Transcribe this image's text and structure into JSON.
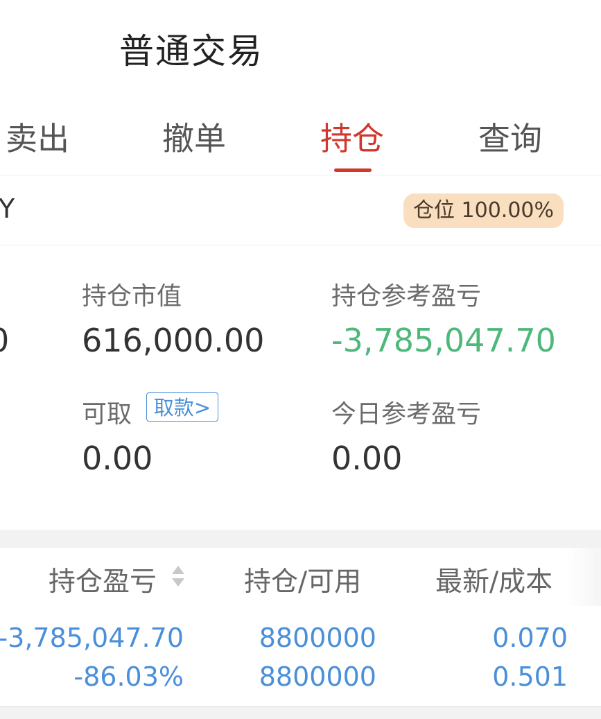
{
  "header": {
    "title": "普通交易"
  },
  "tabs": [
    {
      "label": "卖出",
      "active": false
    },
    {
      "label": "撤单",
      "active": false
    },
    {
      "label": "持仓",
      "active": true
    },
    {
      "label": "查询",
      "active": false
    }
  ],
  "account": {
    "name_fragment": "Y",
    "position_badge": "仓位 100.00%"
  },
  "summary": {
    "left_partial_value": "0",
    "market_value_label": "持仓市值",
    "market_value": "616,000.00",
    "ref_pl_label": "持仓参考盈亏",
    "ref_pl": "-3,785,047.70",
    "withdrawable_label": "可取",
    "withdraw_button": "取款>",
    "withdrawable": "0.00",
    "today_pl_label": "今日参考盈亏",
    "today_pl": "0.00"
  },
  "table": {
    "headers": {
      "pl": "持仓盈亏",
      "holding": "持仓/可用",
      "price": "最新/成本"
    },
    "rows": [
      {
        "pl_amount": "-3,785,047.70",
        "pl_percent": "-86.03%",
        "holding": "8800000",
        "available": "8800000",
        "latest": "0.070",
        "cost": "0.501"
      }
    ]
  },
  "colors": {
    "accent_red": "#d0372d",
    "loss_green": "#4eb87a",
    "link_blue": "#4a8fd9",
    "badge_bg": "#f9dfbf"
  }
}
